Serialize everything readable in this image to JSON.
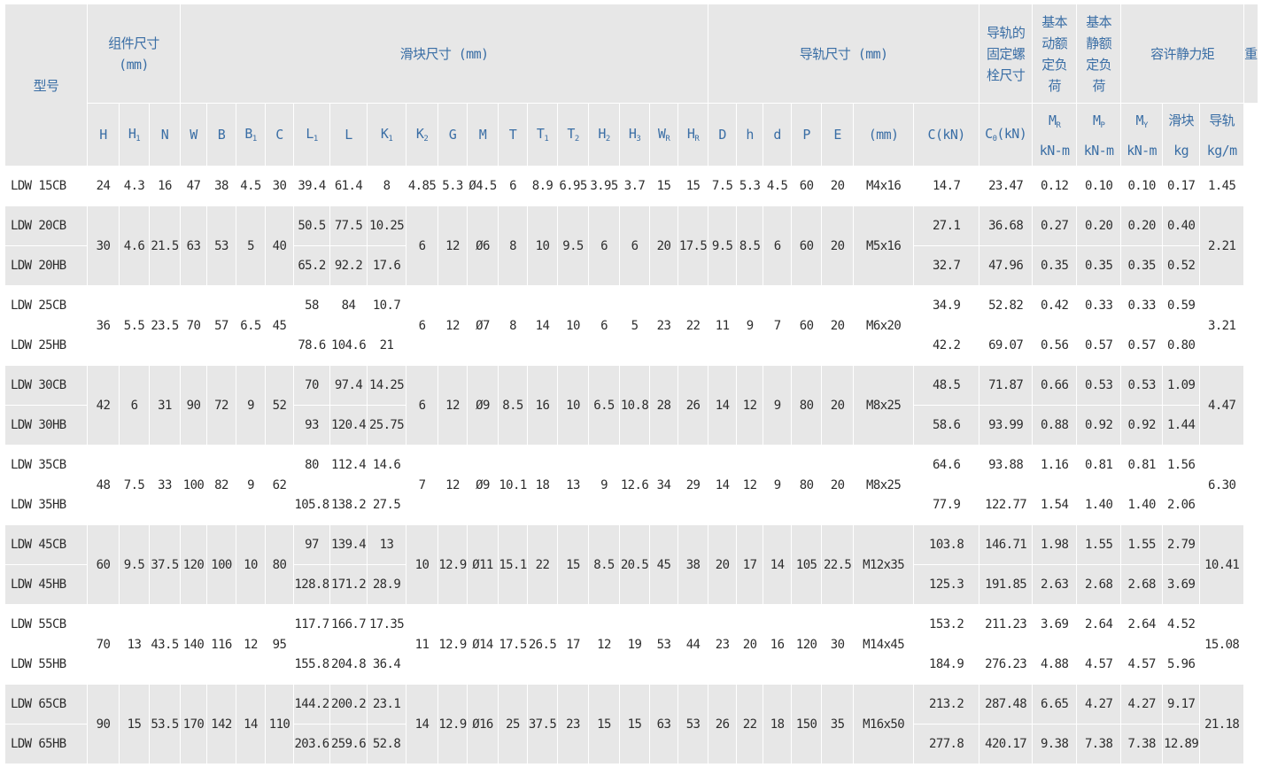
{
  "headers": {
    "model": "型号",
    "group_assembly": "组件尺寸",
    "group_assembly_unit": "(mm)",
    "group_block": "滑块尺寸 (mm)",
    "group_rail": "导轨尺寸 (mm)",
    "group_bolt": "导轨的固定螺栓尺寸",
    "group_dyn": "基本动额定负荷",
    "group_static": "基本静额定负荷",
    "group_moment": "容许静力矩",
    "group_weight": "重量",
    "bolt_unit": "(mm)",
    "c_label": "C(kN)",
    "c0_label": "C",
    "c0_sub": "0",
    "c0_suffix": "(kN)",
    "mr": "M",
    "mr_sub": "R",
    "mp": "M",
    "mp_sub": "P",
    "my": "M",
    "my_sub": "Y",
    "moment_unit": "kN-m",
    "weight_block": "滑块",
    "weight_block_unit": "kg",
    "weight_rail": "导轨",
    "weight_rail_unit": "kg/m",
    "cols": {
      "H": "H",
      "H1": "H",
      "H1s": "1",
      "N": "N",
      "W": "W",
      "B": "B",
      "B1": "B",
      "B1s": "1",
      "C": "C",
      "L1": "L",
      "L1s": "1",
      "L": "L",
      "K1": "K",
      "K1s": "1",
      "K2": "K",
      "K2s": "2",
      "G": "G",
      "M": "M",
      "T": "T",
      "T1": "T",
      "T1s": "1",
      "T2": "T",
      "T2s": "2",
      "H2": "H",
      "H2s": "2",
      "H3": "H",
      "H3s": "3",
      "WR": "W",
      "WRs": "R",
      "HR": "H",
      "HRs": "R",
      "D": "D",
      "h": "h",
      "d": "d",
      "P": "P",
      "E": "E"
    }
  },
  "groups": [
    {
      "H": "24",
      "H1": "4.3",
      "N": "16",
      "W": "47",
      "B": "38",
      "B1": "4.5",
      "C": "30",
      "K2": "4.85",
      "G": "5.3",
      "M": "Ø4.5",
      "T": "6",
      "T1": "8.9",
      "T2": "6.95",
      "H2": "3.95",
      "H3": "3.7",
      "WR": "15",
      "HR": "15",
      "D": "7.5",
      "h": "5.3",
      "d": "4.5",
      "P": "60",
      "E": "20",
      "bolt": "M4x16",
      "rail": "1.45",
      "rows": [
        {
          "model": "LDW 15CB",
          "L1": "39.4",
          "L": "61.4",
          "K1": "8",
          "C_kN": "14.7",
          "C0_kN": "23.47",
          "MR": "0.12",
          "MP": "0.10",
          "MY": "0.10",
          "block": "0.17"
        }
      ]
    },
    {
      "H": "30",
      "H1": "4.6",
      "N": "21.5",
      "W": "63",
      "B": "53",
      "B1": "5",
      "C": "40",
      "K2": "6",
      "G": "12",
      "M": "Ø6",
      "T": "8",
      "T1": "10",
      "T2": "9.5",
      "H2": "6",
      "H3": "6",
      "WR": "20",
      "HR": "17.5",
      "D": "9.5",
      "h": "8.5",
      "d": "6",
      "P": "60",
      "E": "20",
      "bolt": "M5x16",
      "rail": "2.21",
      "rows": [
        {
          "model": "LDW 20CB",
          "L1": "50.5",
          "L": "77.5",
          "K1": "10.25",
          "C_kN": "27.1",
          "C0_kN": "36.68",
          "MR": "0.27",
          "MP": "0.20",
          "MY": "0.20",
          "block": "0.40"
        },
        {
          "model": "LDW 20HB",
          "L1": "65.2",
          "L": "92.2",
          "K1": "17.6",
          "C_kN": "32.7",
          "C0_kN": "47.96",
          "MR": "0.35",
          "MP": "0.35",
          "MY": "0.35",
          "block": "0.52"
        }
      ]
    },
    {
      "H": "36",
      "H1": "5.5",
      "N": "23.5",
      "W": "70",
      "B": "57",
      "B1": "6.5",
      "C": "45",
      "K2": "6",
      "G": "12",
      "M": "Ø7",
      "T": "8",
      "T1": "14",
      "T2": "10",
      "H2": "6",
      "H3": "5",
      "WR": "23",
      "HR": "22",
      "D": "11",
      "h": "9",
      "d": "7",
      "P": "60",
      "E": "20",
      "bolt": "M6x20",
      "rail": "3.21",
      "rows": [
        {
          "model": "LDW 25CB",
          "L1": "58",
          "L": "84",
          "K1": "10.7",
          "C_kN": "34.9",
          "C0_kN": "52.82",
          "MR": "0.42",
          "MP": "0.33",
          "MY": "0.33",
          "block": "0.59"
        },
        {
          "model": "LDW 25HB",
          "L1": "78.6",
          "L": "104.6",
          "K1": "21",
          "C_kN": "42.2",
          "C0_kN": "69.07",
          "MR": "0.56",
          "MP": "0.57",
          "MY": "0.57",
          "block": "0.80"
        }
      ]
    },
    {
      "H": "42",
      "H1": "6",
      "N": "31",
      "W": "90",
      "B": "72",
      "B1": "9",
      "C": "52",
      "K2": "6",
      "G": "12",
      "M": "Ø9",
      "T": "8.5",
      "T1": "16",
      "T2": "10",
      "H2": "6.5",
      "H3": "10.8",
      "WR": "28",
      "HR": "26",
      "D": "14",
      "h": "12",
      "d": "9",
      "P": "80",
      "E": "20",
      "bolt": "M8x25",
      "rail": "4.47",
      "rows": [
        {
          "model": "LDW 30CB",
          "L1": "70",
          "L": "97.4",
          "K1": "14.25",
          "C_kN": "48.5",
          "C0_kN": "71.87",
          "MR": "0.66",
          "MP": "0.53",
          "MY": "0.53",
          "block": "1.09"
        },
        {
          "model": "LDW 30HB",
          "L1": "93",
          "L": "120.4",
          "K1": "25.75",
          "C_kN": "58.6",
          "C0_kN": "93.99",
          "MR": "0.88",
          "MP": "0.92",
          "MY": "0.92",
          "block": "1.44"
        }
      ]
    },
    {
      "H": "48",
      "H1": "7.5",
      "N": "33",
      "W": "100",
      "B": "82",
      "B1": "9",
      "C": "62",
      "K2": "7",
      "G": "12",
      "M": "Ø9",
      "T": "10.1",
      "T1": "18",
      "T2": "13",
      "H2": "9",
      "H3": "12.6",
      "WR": "34",
      "HR": "29",
      "D": "14",
      "h": "12",
      "d": "9",
      "P": "80",
      "E": "20",
      "bolt": "M8x25",
      "rail": "6.30",
      "rows": [
        {
          "model": "LDW 35CB",
          "L1": "80",
          "L": "112.4",
          "K1": "14.6",
          "C_kN": "64.6",
          "C0_kN": "93.88",
          "MR": "1.16",
          "MP": "0.81",
          "MY": "0.81",
          "block": "1.56"
        },
        {
          "model": "LDW 35HB",
          "L1": "105.8",
          "L": "138.2",
          "K1": "27.5",
          "C_kN": "77.9",
          "C0_kN": "122.77",
          "MR": "1.54",
          "MP": "1.40",
          "MY": "1.40",
          "block": "2.06"
        }
      ]
    },
    {
      "H": "60",
      "H1": "9.5",
      "N": "37.5",
      "W": "120",
      "B": "100",
      "B1": "10",
      "C": "80",
      "K2": "10",
      "G": "12.9",
      "M": "Ø11",
      "T": "15.1",
      "T1": "22",
      "T2": "15",
      "H2": "8.5",
      "H3": "20.5",
      "WR": "45",
      "HR": "38",
      "D": "20",
      "h": "17",
      "d": "14",
      "P": "105",
      "E": "22.5",
      "bolt": "M12x35",
      "rail": "10.41",
      "rows": [
        {
          "model": "LDW 45CB",
          "L1": "97",
          "L": "139.4",
          "K1": "13",
          "C_kN": "103.8",
          "C0_kN": "146.71",
          "MR": "1.98",
          "MP": "1.55",
          "MY": "1.55",
          "block": "2.79"
        },
        {
          "model": "LDW 45HB",
          "L1": "128.8",
          "L": "171.2",
          "K1": "28.9",
          "C_kN": "125.3",
          "C0_kN": "191.85",
          "MR": "2.63",
          "MP": "2.68",
          "MY": "2.68",
          "block": "3.69"
        }
      ]
    },
    {
      "H": "70",
      "H1": "13",
      "N": "43.5",
      "W": "140",
      "B": "116",
      "B1": "12",
      "C": "95",
      "K2": "11",
      "G": "12.9",
      "M": "Ø14",
      "T": "17.5",
      "T1": "26.5",
      "T2": "17",
      "H2": "12",
      "H3": "19",
      "WR": "53",
      "HR": "44",
      "D": "23",
      "h": "20",
      "d": "16",
      "P": "120",
      "E": "30",
      "bolt": "M14x45",
      "rail": "15.08",
      "rows": [
        {
          "model": "LDW 55CB",
          "L1": "117.7",
          "L": "166.7",
          "K1": "17.35",
          "C_kN": "153.2",
          "C0_kN": "211.23",
          "MR": "3.69",
          "MP": "2.64",
          "MY": "2.64",
          "block": "4.52"
        },
        {
          "model": "LDW 55HB",
          "L1": "155.8",
          "L": "204.8",
          "K1": "36.4",
          "C_kN": "184.9",
          "C0_kN": "276.23",
          "MR": "4.88",
          "MP": "4.57",
          "MY": "4.57",
          "block": "5.96"
        }
      ]
    },
    {
      "H": "90",
      "H1": "15",
      "N": "53.5",
      "W": "170",
      "B": "142",
      "B1": "14",
      "C": "110",
      "K2": "14",
      "G": "12.9",
      "M": "Ø16",
      "T": "25",
      "T1": "37.5",
      "T2": "23",
      "H2": "15",
      "H3": "15",
      "WR": "63",
      "HR": "53",
      "D": "26",
      "h": "22",
      "d": "18",
      "P": "150",
      "E": "35",
      "bolt": "M16x50",
      "rail": "21.18",
      "rows": [
        {
          "model": "LDW 65CB",
          "L1": "144.2",
          "L": "200.2",
          "K1": "23.1",
          "C_kN": "213.2",
          "C0_kN": "287.48",
          "MR": "6.65",
          "MP": "4.27",
          "MY": "4.27",
          "block": "9.17"
        },
        {
          "model": "LDW 65HB",
          "L1": "203.6",
          "L": "259.6",
          "K1": "52.8",
          "C_kN": "277.8",
          "C0_kN": "420.17",
          "MR": "9.38",
          "MP": "7.38",
          "MY": "7.38",
          "block": "12.89"
        }
      ]
    }
  ]
}
